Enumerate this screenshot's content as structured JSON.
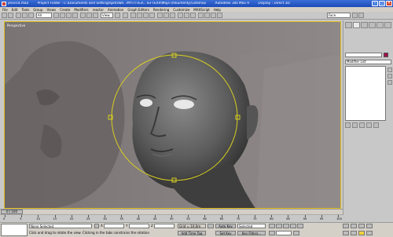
{
  "window": {
    "file_name": "jecie14.max",
    "project_folder": "Project Folder : C:\\Documents and Settings\\pdrzwh...MY\\T\\TE3\\...\\EFTEX4\\Maja (mkumenty)\\3dsmax",
    "app_title": "Autodesk 3ds Max 9",
    "display": "Display : Direct 3D"
  },
  "menu": [
    "File",
    "Edit",
    "Tools",
    "Group",
    "Views",
    "Create",
    "Modifiers",
    "reactor",
    "Animation",
    "Graph Editors",
    "Rendering",
    "Customize",
    "MAXScript",
    "Help"
  ],
  "toolbar": {
    "filter_value": "All",
    "refcoord_value": "View",
    "named_sel_value": "Face"
  },
  "viewport": {
    "label": "Perspective"
  },
  "command_panel": {
    "modifier_list": "Modifier List"
  },
  "time": {
    "current": "0 / 100",
    "ticks": [
      "0",
      "5",
      "10",
      "15",
      "20",
      "25",
      "30",
      "35",
      "40",
      "45",
      "50",
      "55",
      "60",
      "65",
      "70",
      "75",
      "80",
      "85",
      "90",
      "95",
      "100"
    ]
  },
  "status": {
    "selection": "None Selected",
    "prompt": "Click and drag to rotate the view.  Clicking in the tabs constrains the rotation",
    "x_label": "X",
    "y_label": "Y",
    "z_label": "Z",
    "grid": "Grid = 10,0m",
    "add_time_tag": "Add Time Tag",
    "auto_key": "Auto Key",
    "set_key": "Set Key",
    "selected": "Selected",
    "key_filters": "Key Filters..."
  },
  "colors": {
    "title_bar": "#1c4ab8",
    "selection_gizmo": "#d8d020",
    "object_color": "#a0104a"
  }
}
